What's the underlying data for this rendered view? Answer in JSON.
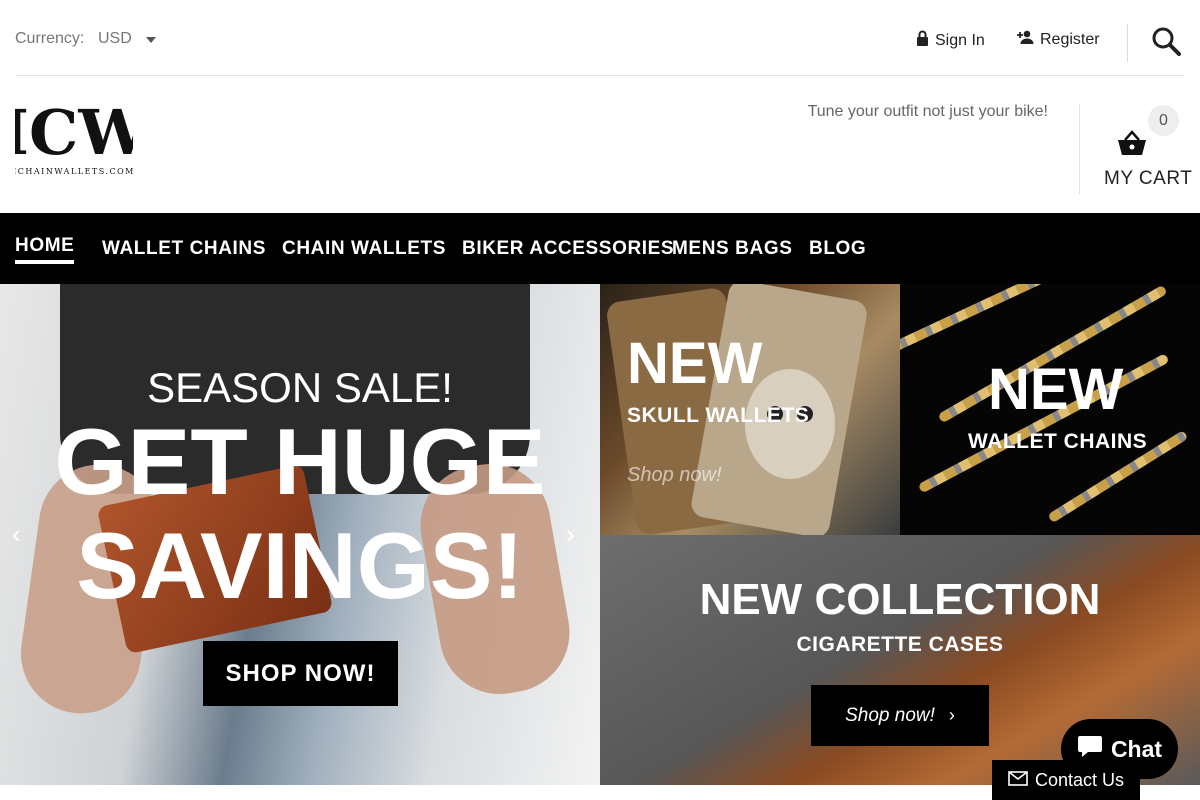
{
  "topbar": {
    "currency_label": "Currency:",
    "currency_value": "USD",
    "sign_in": "Sign In",
    "register": "Register"
  },
  "header": {
    "logo_alt": "ICHAINWALLETS.COM",
    "tagline": "Tune your outfit not just your bike!",
    "cart_count": "0",
    "cart_label": "MY CART"
  },
  "nav": {
    "items": [
      "HOME",
      "WALLET CHAINS",
      "CHAIN WALLETS",
      "BIKER ACCESSORIES",
      "MENS BAGS",
      "BLOG"
    ]
  },
  "hero": {
    "line1": "SEASON SALE!",
    "line2": "GET HUGE",
    "line3": "SAVINGS!",
    "button": "SHOP NOW!"
  },
  "tiles": {
    "skull": {
      "title": "NEW",
      "subtitle": "SKULL WALLETS",
      "link": "Shop now!"
    },
    "chains": {
      "title": "NEW",
      "subtitle": "WALLET CHAINS"
    },
    "cases": {
      "title": "NEW COLLECTION",
      "subtitle": "CIGARETTE CASES",
      "button": "Shop now!"
    }
  },
  "widgets": {
    "chat": "Chat",
    "contact": "Contact Us"
  },
  "colors": {
    "nav_bg": "#000000",
    "accent": "#000000"
  }
}
